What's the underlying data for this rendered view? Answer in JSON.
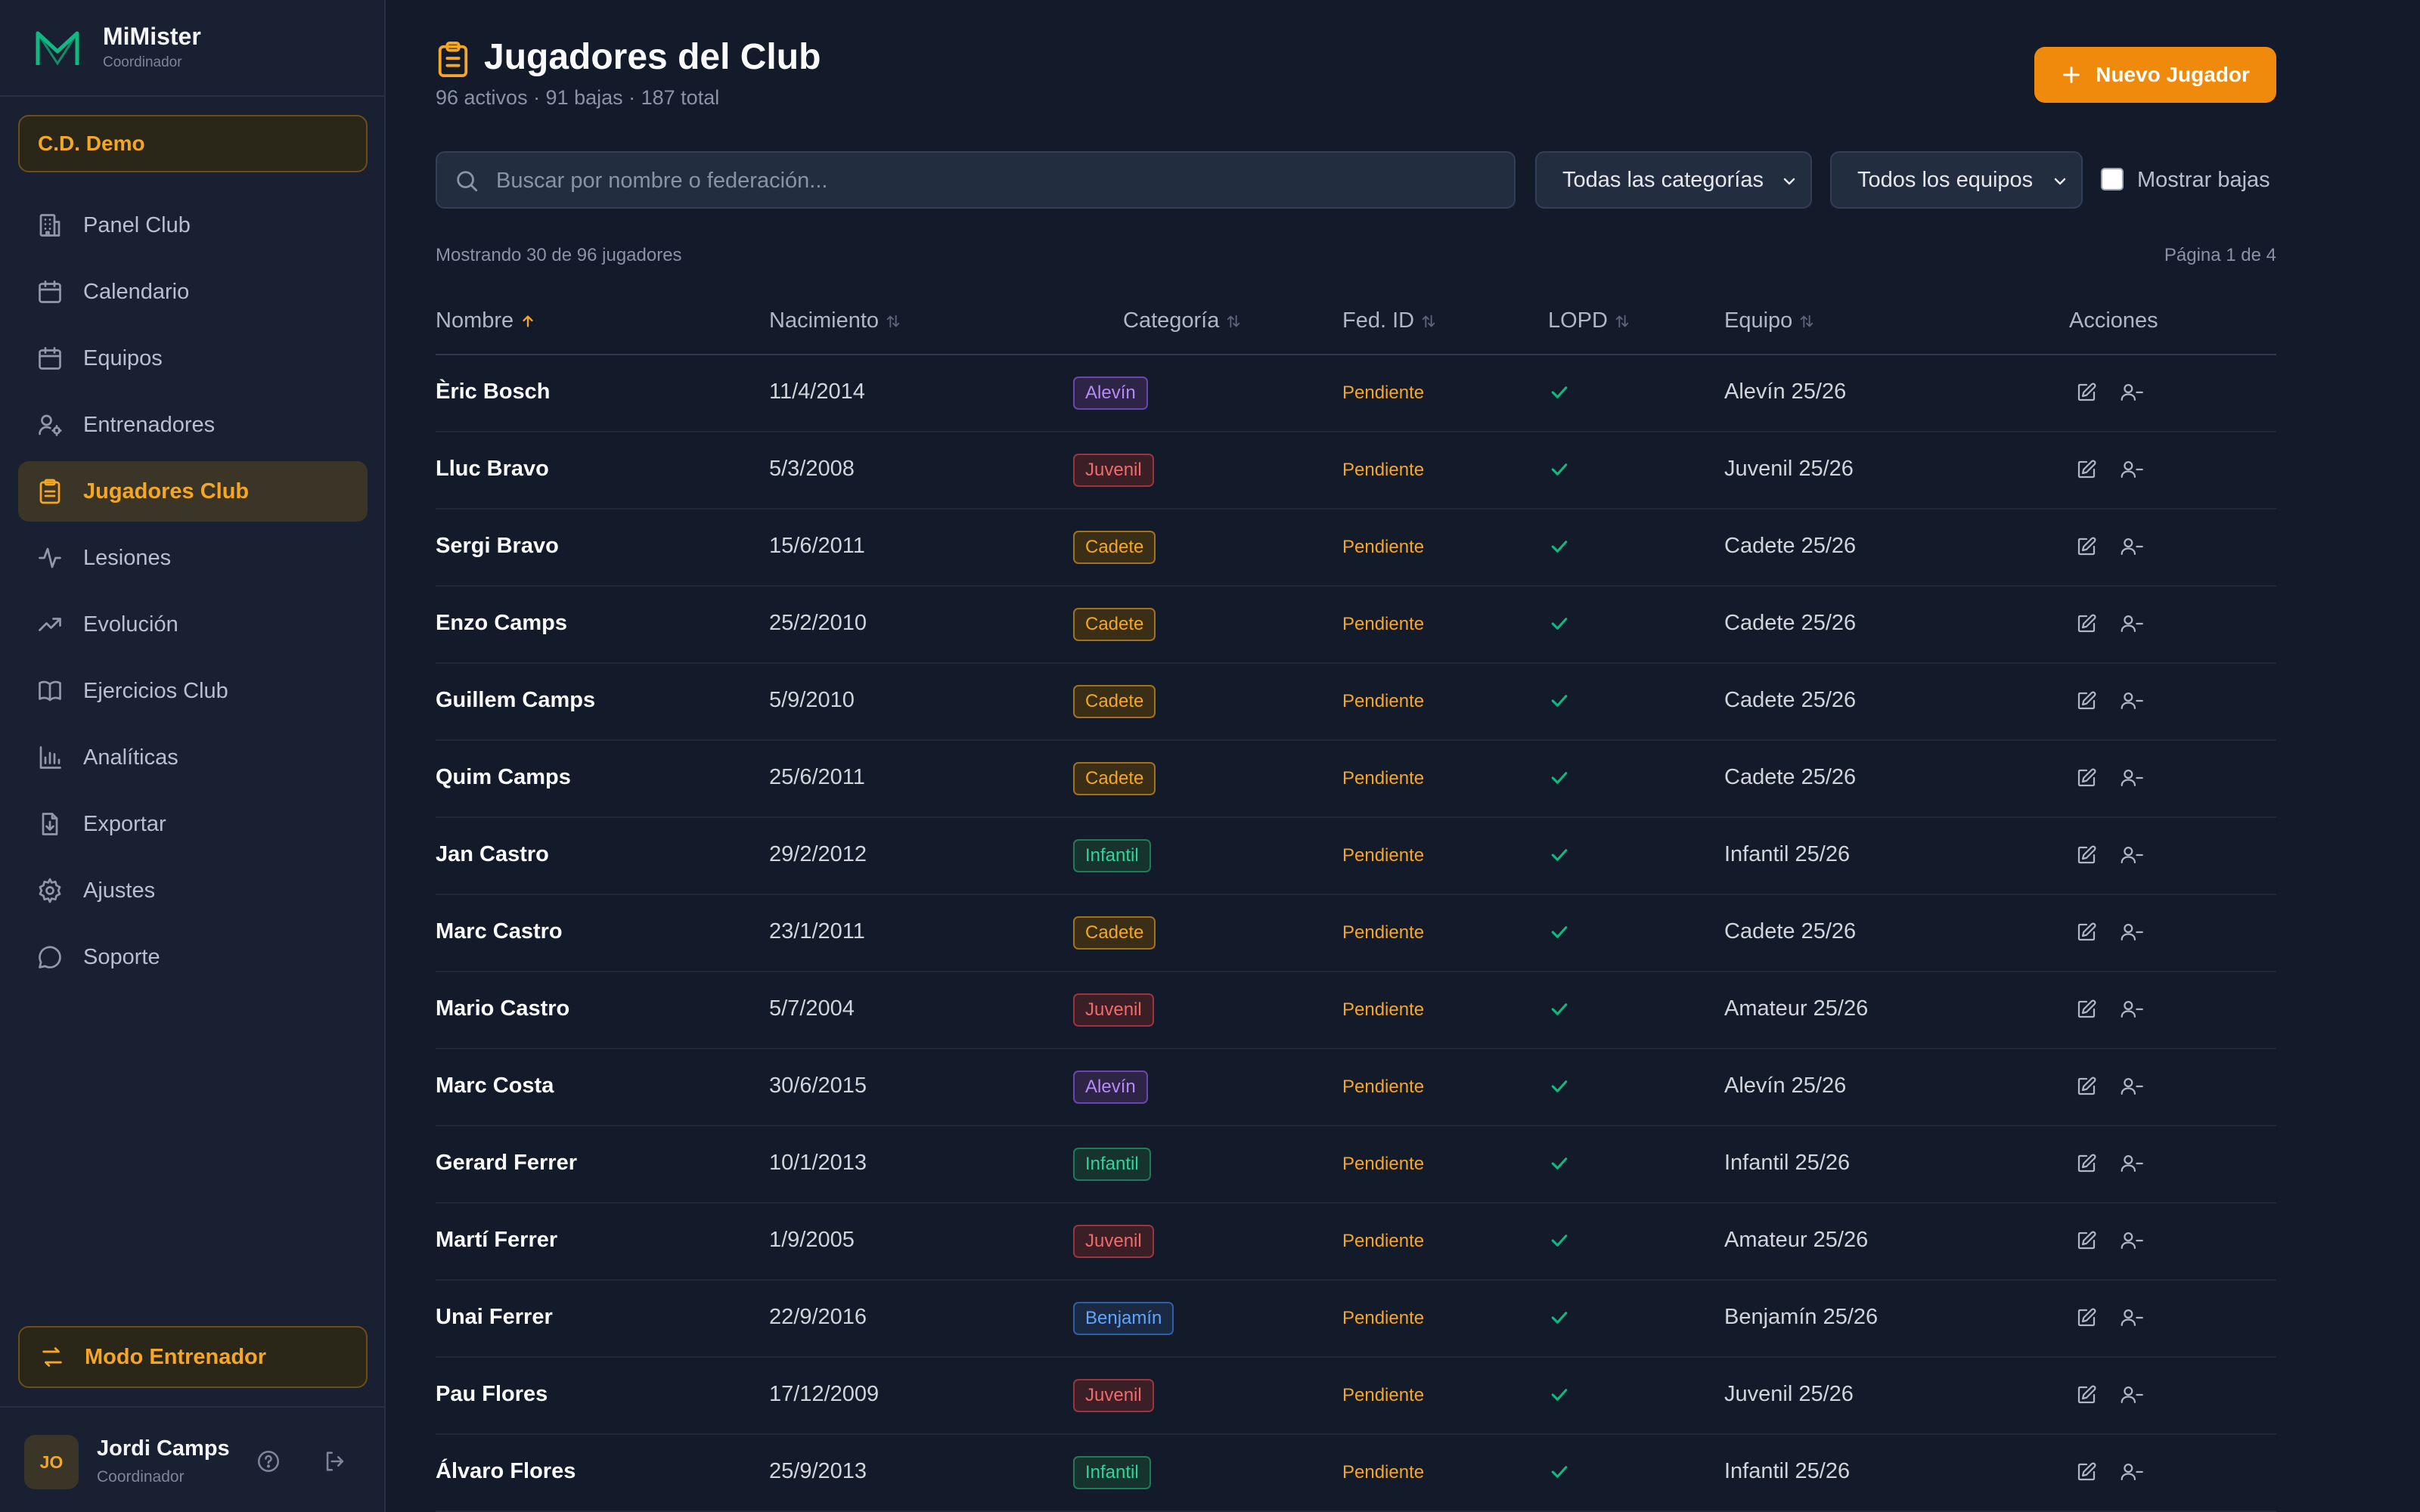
{
  "app": {
    "name": "MiMister",
    "role": "Coordinador"
  },
  "club": "C.D. Demo",
  "nav": [
    {
      "label": "Panel Club",
      "icon": "building-icon",
      "active": false
    },
    {
      "label": "Calendario",
      "icon": "calendar-icon",
      "active": false
    },
    {
      "label": "Equipos",
      "icon": "calendar-icon",
      "active": false
    },
    {
      "label": "Entrenadores",
      "icon": "user-cog-icon",
      "active": false
    },
    {
      "label": "Jugadores Club",
      "icon": "clipboard-icon",
      "active": true
    },
    {
      "label": "Lesiones",
      "icon": "activity-icon",
      "active": false
    },
    {
      "label": "Evolución",
      "icon": "trending-up-icon",
      "active": false
    },
    {
      "label": "Ejercicios Club",
      "icon": "book-icon",
      "active": false
    },
    {
      "label": "Analíticas",
      "icon": "bar-chart-icon",
      "active": false
    },
    {
      "label": "Exportar",
      "icon": "file-download-icon",
      "active": false
    },
    {
      "label": "Ajustes",
      "icon": "gear-icon",
      "active": false
    },
    {
      "label": "Soporte",
      "icon": "chat-bubble-icon",
      "active": false
    }
  ],
  "coach_mode": "Modo Entrenador",
  "user": {
    "initials": "JO",
    "name": "Jordi Camps",
    "role": "Coordinador"
  },
  "page": {
    "title": "Jugadores del Club",
    "subtitle": "96 activos · 91 bajas · 187 total",
    "new_button": "Nuevo Jugador"
  },
  "filters": {
    "search_placeholder": "Buscar por nombre o federación...",
    "search_value": "",
    "category": "Todas las categorías",
    "team": "Todos los equipos",
    "show_inactive_label": "Mostrar bajas",
    "show_inactive": false
  },
  "list_info": {
    "showing": "Mostrando 30 de 96 jugadores",
    "page": "Página 1 de 4"
  },
  "columns": [
    "Nombre",
    "Nacimiento",
    "Categoría",
    "Fed. ID",
    "LOPD",
    "Equipo",
    "Acciones"
  ],
  "sort": {
    "column": "Nombre",
    "direction": "asc"
  },
  "category_colors": {
    "Alevín": {
      "fg": "#b38cf5",
      "bg": "#2e2445",
      "border": "#6a45b0"
    },
    "Juvenil": {
      "fg": "#f06a6a",
      "bg": "#3a1f27",
      "border": "#9e3340"
    },
    "Cadete": {
      "fg": "#f5a623",
      "bg": "#3a2e17",
      "border": "#a3701c"
    },
    "Infantil": {
      "fg": "#34d399",
      "bg": "#16332d",
      "border": "#1f7a5a"
    },
    "Benjamín": {
      "fg": "#60a5fa",
      "bg": "#1a2a44",
      "border": "#2f5ea8"
    }
  },
  "rows": [
    {
      "name": "Èric Bosch",
      "birth": "11/4/2014",
      "category": "Alevín",
      "fed": "Pendiente",
      "lopd": true,
      "team": "Alevín 25/26"
    },
    {
      "name": "Lluc Bravo",
      "birth": "5/3/2008",
      "category": "Juvenil",
      "fed": "Pendiente",
      "lopd": true,
      "team": "Juvenil 25/26"
    },
    {
      "name": "Sergi Bravo",
      "birth": "15/6/2011",
      "category": "Cadete",
      "fed": "Pendiente",
      "lopd": true,
      "team": "Cadete 25/26"
    },
    {
      "name": "Enzo Camps",
      "birth": "25/2/2010",
      "category": "Cadete",
      "fed": "Pendiente",
      "lopd": true,
      "team": "Cadete 25/26"
    },
    {
      "name": "Guillem Camps",
      "birth": "5/9/2010",
      "category": "Cadete",
      "fed": "Pendiente",
      "lopd": true,
      "team": "Cadete 25/26"
    },
    {
      "name": "Quim Camps",
      "birth": "25/6/2011",
      "category": "Cadete",
      "fed": "Pendiente",
      "lopd": true,
      "team": "Cadete 25/26"
    },
    {
      "name": "Jan Castro",
      "birth": "29/2/2012",
      "category": "Infantil",
      "fed": "Pendiente",
      "lopd": true,
      "team": "Infantil 25/26"
    },
    {
      "name": "Marc Castro",
      "birth": "23/1/2011",
      "category": "Cadete",
      "fed": "Pendiente",
      "lopd": true,
      "team": "Cadete 25/26"
    },
    {
      "name": "Mario Castro",
      "birth": "5/7/2004",
      "category": "Juvenil",
      "fed": "Pendiente",
      "lopd": true,
      "team": "Amateur 25/26"
    },
    {
      "name": "Marc Costa",
      "birth": "30/6/2015",
      "category": "Alevín",
      "fed": "Pendiente",
      "lopd": true,
      "team": "Alevín 25/26"
    },
    {
      "name": "Gerard Ferrer",
      "birth": "10/1/2013",
      "category": "Infantil",
      "fed": "Pendiente",
      "lopd": true,
      "team": "Infantil 25/26"
    },
    {
      "name": "Martí Ferrer",
      "birth": "1/9/2005",
      "category": "Juvenil",
      "fed": "Pendiente",
      "lopd": true,
      "team": "Amateur 25/26"
    },
    {
      "name": "Unai Ferrer",
      "birth": "22/9/2016",
      "category": "Benjamín",
      "fed": "Pendiente",
      "lopd": true,
      "team": "Benjamín 25/26"
    },
    {
      "name": "Pau Flores",
      "birth": "17/12/2009",
      "category": "Juvenil",
      "fed": "Pendiente",
      "lopd": true,
      "team": "Juvenil 25/26"
    },
    {
      "name": "Álvaro Flores",
      "birth": "25/9/2013",
      "category": "Infantil",
      "fed": "Pendiente",
      "lopd": true,
      "team": "Infantil 25/26"
    }
  ]
}
